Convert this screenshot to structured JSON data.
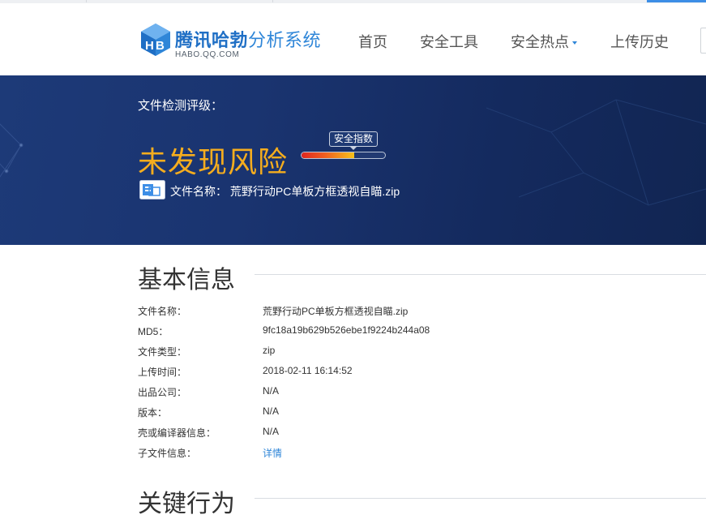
{
  "header": {
    "logo_brand": "腾讯哈勃",
    "logo_product": "分析系统",
    "logo_sub": "HABO.QQ.COM",
    "nav": [
      {
        "label": "首页"
      },
      {
        "label": "安全工具"
      },
      {
        "label": "安全热点",
        "dropdown": true
      },
      {
        "label": "上传历史"
      }
    ]
  },
  "banner": {
    "rating_label": "文件检测评级：",
    "verdict": "未发现风险",
    "verdict_color": "#f5ad1e",
    "meter_label": "安全指数",
    "meter_fraction": 0.63,
    "file_name_text": "文件名称： 荒野行动PC单板方框透视自瞄.zip",
    "file_icon": "archive-file-icon"
  },
  "basic": {
    "title": "基本信息",
    "rows": [
      {
        "label": "文件名称：",
        "value": "荒野行动PC单板方框透视自瞄.zip"
      },
      {
        "label": "MD5：",
        "value": "9fc18a19b629b526ebe1f9224b244a08"
      },
      {
        "label": "文件类型：",
        "value": "zip"
      },
      {
        "label": "上传时间：",
        "value": "2018-02-11 16:14:52"
      },
      {
        "label": "出品公司：",
        "value": "N/A"
      },
      {
        "label": "版本：",
        "value": "N/A"
      },
      {
        "label": "壳或编译器信息：",
        "value": "N/A"
      },
      {
        "label": "子文件信息：",
        "value": "详情",
        "link": true
      }
    ]
  },
  "behavior": {
    "title": "关键行为"
  },
  "colors": {
    "brand_blue": "#1f6fc5",
    "banner_bg": "#1a3470",
    "link": "#2f86d8"
  }
}
